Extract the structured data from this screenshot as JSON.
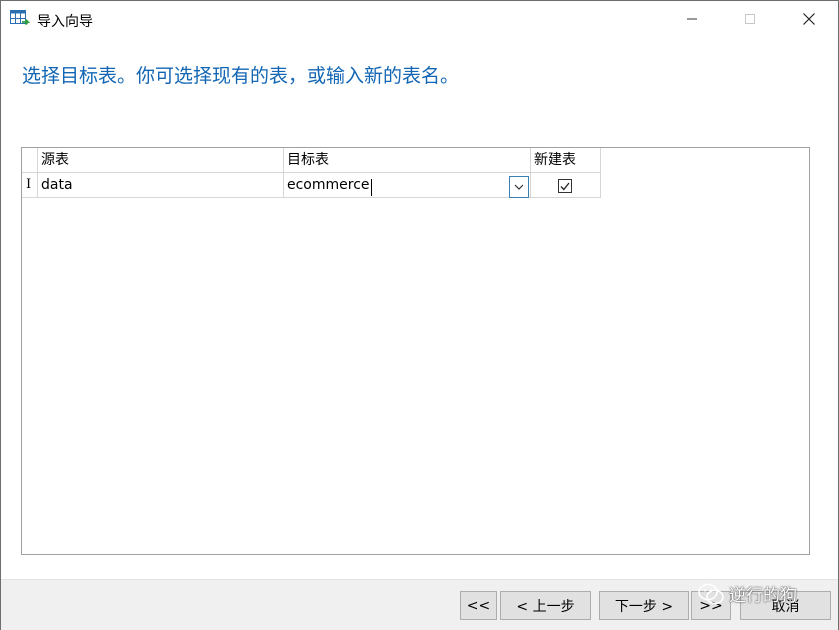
{
  "window": {
    "title": "导入向导",
    "controls": {
      "minimize": "—",
      "maximize": "☐",
      "close": "✕"
    }
  },
  "heading": "选择目标表。你可选择现有的表，或输入新的表名。",
  "grid": {
    "columns": [
      "源表",
      "目标表",
      "新建表"
    ],
    "rows": [
      {
        "indicator": "I",
        "source": "data",
        "target": "ecommerce",
        "new_table": true
      }
    ]
  },
  "footer": {
    "first_label": "<<",
    "prev_label": "< 上一步",
    "next_label": "下一步 >",
    "last_label": ">>",
    "cancel_label": "取消"
  },
  "watermark": {
    "text": "逆行的狗",
    "icon": "wechat-icon"
  },
  "colors": {
    "heading": "#1266b3",
    "accent": "#3c7fb1",
    "footer_bg": "#f0f0f0"
  }
}
